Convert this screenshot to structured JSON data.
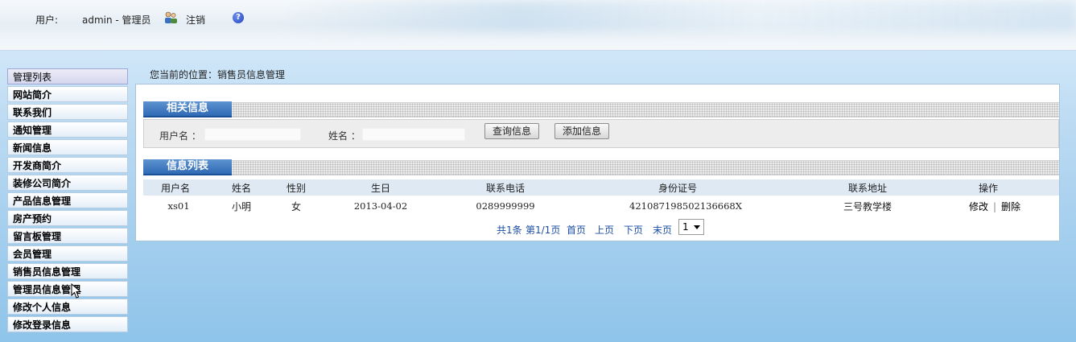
{
  "header": {
    "user_label": "用户:",
    "user_name": "admin - 管理员",
    "logout_label": "注销",
    "help_glyph": "?"
  },
  "sidebar": {
    "items": [
      {
        "label": "管理列表"
      },
      {
        "label": "网站简介"
      },
      {
        "label": "联系我们"
      },
      {
        "label": "通知管理"
      },
      {
        "label": "新闻信息"
      },
      {
        "label": "开发商简介"
      },
      {
        "label": "装修公司简介"
      },
      {
        "label": "产品信息管理"
      },
      {
        "label": "房产预约"
      },
      {
        "label": "留言板管理"
      },
      {
        "label": "会员管理"
      },
      {
        "label": "销售员信息管理"
      },
      {
        "label": "管理员信息管理"
      },
      {
        "label": "修改个人信息"
      },
      {
        "label": "修改登录信息"
      }
    ]
  },
  "breadcrumb": "您当前的位置：销售员信息管理",
  "search": {
    "section_title": "相关信息",
    "username_label": "用户名 ：",
    "username_value": "",
    "name_label": "姓名 ：",
    "name_value": "",
    "query_button": "查询信息",
    "add_button": "添加信息"
  },
  "list": {
    "section_title": "信息列表",
    "columns": [
      "用户名",
      "姓名",
      "性别",
      "生日",
      "联系电话",
      "身份证号",
      "联系地址",
      "操作"
    ],
    "rows": [
      {
        "username": "xs01",
        "name": "小明",
        "gender": "女",
        "birthday": "2013-04-02",
        "phone": "0289999999",
        "id_number": "421087198502136668X",
        "address": "三号教学楼",
        "edit": "修改",
        "separator": "|",
        "delete": "删除"
      }
    ]
  },
  "pager": {
    "total": "共1条",
    "page_info": "第1/1页",
    "first": "首页",
    "prev": "上页",
    "next": "下页",
    "last": "末页",
    "current_page": "1"
  },
  "colors": {
    "section_title_bg": "#2f6ab5",
    "pager_link": "#1b4ea3",
    "table_header_bg": "#dfe9f4"
  }
}
